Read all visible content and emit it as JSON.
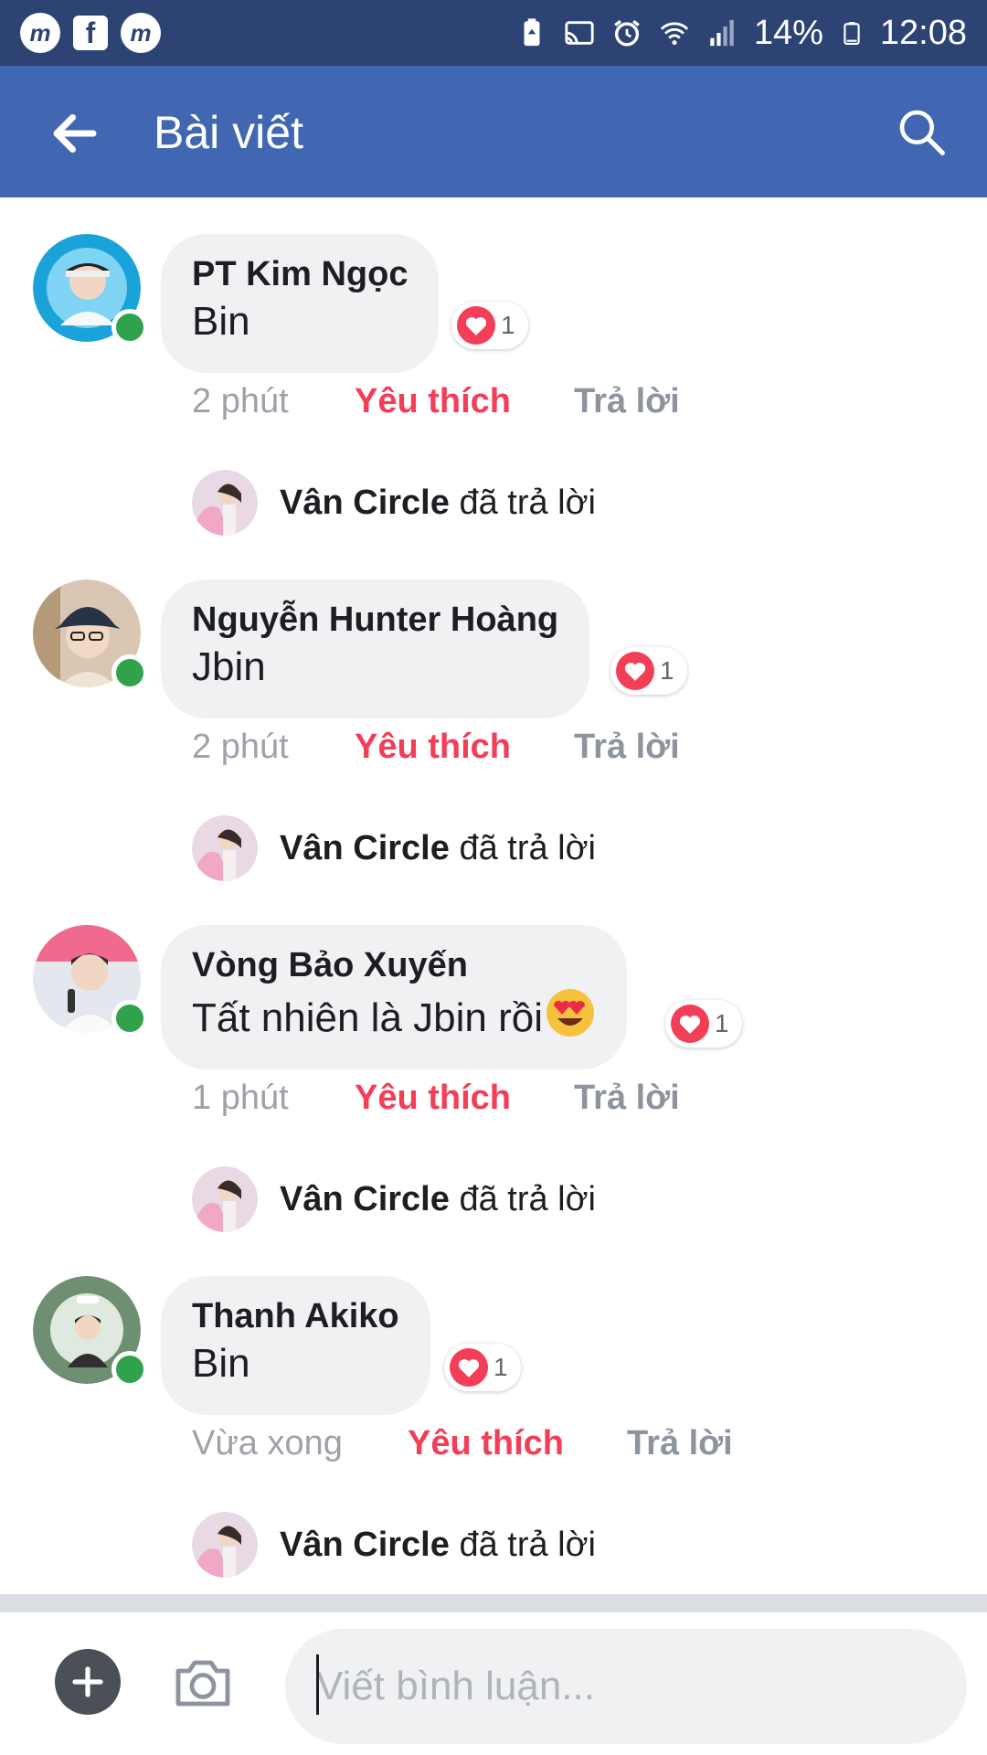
{
  "status_bar": {
    "left_icons": [
      "messenger-icon",
      "facebook-icon",
      "messenger-lite-icon"
    ],
    "right_icons": [
      "battery-saver-icon",
      "cast-icon",
      "alarm-icon",
      "wifi-icon",
      "signal-icon"
    ],
    "battery": "14%",
    "time": "12:08"
  },
  "app_bar": {
    "title": "Bài viết",
    "back_icon": "back-arrow-icon",
    "search_icon": "search-icon"
  },
  "comments": [
    {
      "author": "PT Kim Ngọc",
      "text": "Bin",
      "reaction_count": "1",
      "time": "2 phút",
      "like_label": "Yêu thích",
      "reply_label": "Trả lời",
      "reply": {
        "name": "Vân Circle",
        "suffix": "đã trả lời"
      }
    },
    {
      "author": "Nguyễn Hunter Hoàng",
      "text": "Jbin",
      "reaction_count": "1",
      "time": "2 phút",
      "like_label": "Yêu thích",
      "reply_label": "Trả lời",
      "reply": {
        "name": "Vân Circle",
        "suffix": "đã trả lời"
      }
    },
    {
      "author": "Vòng Bảo Xuyến",
      "text": "Tất nhiên là Jbin rồi",
      "text_emoji": "heart-eyes-emoji",
      "reaction_count": "1",
      "time": "1 phút",
      "like_label": "Yêu thích",
      "reply_label": "Trả lời",
      "reply": {
        "name": "Vân Circle",
        "suffix": "đã trả lời"
      }
    },
    {
      "author": "Thanh Akiko",
      "text": "Bin",
      "reaction_count": "1",
      "time": "Vừa xong",
      "like_label": "Yêu thích",
      "reply_label": "Trả lời",
      "reply": {
        "name": "Vân Circle",
        "suffix": "đã trả lời"
      }
    }
  ],
  "composer": {
    "placeholder": "Viết bình luận...",
    "add_icon": "plus-icon",
    "camera_icon": "camera-icon"
  },
  "colors": {
    "status_bar": "#2d4373",
    "app_bar": "#4267b2",
    "like": "#f33e58",
    "online": "#31a24c",
    "bubble": "#f0f1f3"
  }
}
